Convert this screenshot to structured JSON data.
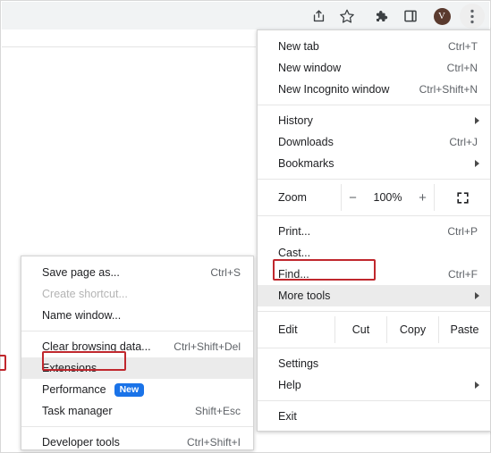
{
  "window": {
    "title": "Google Chrome browser window with three-dot menu open"
  },
  "toolbar": {
    "icons": [
      {
        "name": "share-icon",
        "label": "Share this tab"
      },
      {
        "name": "star-icon",
        "label": "Bookmark this tab"
      },
      {
        "name": "puzzle-icon",
        "label": "Extensions"
      },
      {
        "name": "side-panel-icon",
        "label": "Side panel"
      },
      {
        "name": "avatar-icon",
        "label": "Profile",
        "initial": "V",
        "color": "#5a3a2e"
      },
      {
        "name": "three-dot-icon",
        "label": "Customize and control Google Chrome"
      }
    ]
  },
  "main_menu": {
    "items": [
      {
        "label": "New tab",
        "accel": "Ctrl+T",
        "arrow": false,
        "disabled": false,
        "hovered": false
      },
      {
        "label": "New window",
        "accel": "Ctrl+N",
        "arrow": false,
        "disabled": false,
        "hovered": false
      },
      {
        "label": "New Incognito window",
        "accel": "Ctrl+Shift+N",
        "arrow": false,
        "disabled": false,
        "hovered": false
      },
      {
        "label": "History",
        "accel": "",
        "arrow": true,
        "disabled": false,
        "hovered": false
      },
      {
        "label": "Downloads",
        "accel": "Ctrl+J",
        "arrow": false,
        "disabled": false,
        "hovered": false
      },
      {
        "label": "Bookmarks",
        "accel": "",
        "arrow": true,
        "disabled": false,
        "hovered": false
      },
      {
        "label": "Print...",
        "accel": "Ctrl+P",
        "arrow": false,
        "disabled": false,
        "hovered": false
      },
      {
        "label": "Cast...",
        "accel": "",
        "arrow": false,
        "disabled": false,
        "hovered": false
      },
      {
        "label": "Find...",
        "accel": "Ctrl+F",
        "arrow": false,
        "disabled": false,
        "hovered": false
      },
      {
        "label": "More tools",
        "accel": "",
        "arrow": true,
        "disabled": false,
        "hovered": true
      },
      {
        "label": "Settings",
        "accel": "",
        "arrow": false,
        "disabled": false,
        "hovered": false
      },
      {
        "label": "Help",
        "accel": "",
        "arrow": true,
        "disabled": false,
        "hovered": false
      },
      {
        "label": "Exit",
        "accel": "",
        "arrow": false,
        "disabled": false,
        "hovered": false
      }
    ],
    "zoom_row": {
      "label": "Zoom",
      "minus": "−",
      "value": "100%",
      "plus": "+",
      "fullscreen_icon": "fullscreen-icon"
    },
    "edit_row": {
      "label": "Edit",
      "cut": "Cut",
      "copy": "Copy",
      "paste": "Paste"
    }
  },
  "sub_menu": {
    "items": [
      {
        "label": "Save page as...",
        "accel": "Ctrl+S",
        "disabled": false,
        "hovered": false,
        "badge": ""
      },
      {
        "label": "Create shortcut...",
        "accel": "",
        "disabled": true,
        "hovered": false,
        "badge": ""
      },
      {
        "label": "Name window...",
        "accel": "",
        "disabled": false,
        "hovered": false,
        "badge": ""
      },
      {
        "label": "Clear browsing data...",
        "accel": "Ctrl+Shift+Del",
        "disabled": false,
        "hovered": false,
        "badge": ""
      },
      {
        "label": "Extensions",
        "accel": "",
        "disabled": false,
        "hovered": true,
        "badge": ""
      },
      {
        "label": "Performance",
        "accel": "",
        "disabled": false,
        "hovered": false,
        "badge": "New"
      },
      {
        "label": "Task manager",
        "accel": "Shift+Esc",
        "disabled": false,
        "hovered": false,
        "badge": ""
      },
      {
        "label": "Developer tools",
        "accel": "Ctrl+Shift+I",
        "disabled": false,
        "hovered": false,
        "badge": ""
      }
    ]
  },
  "annotations": {
    "color": "#c0272d",
    "boxes": [
      {
        "name": "highlight-more-tools",
        "target": "More tools"
      },
      {
        "name": "highlight-extensions",
        "target": "Extensions"
      },
      {
        "name": "highlight-edge-marker",
        "target": ""
      }
    ]
  }
}
